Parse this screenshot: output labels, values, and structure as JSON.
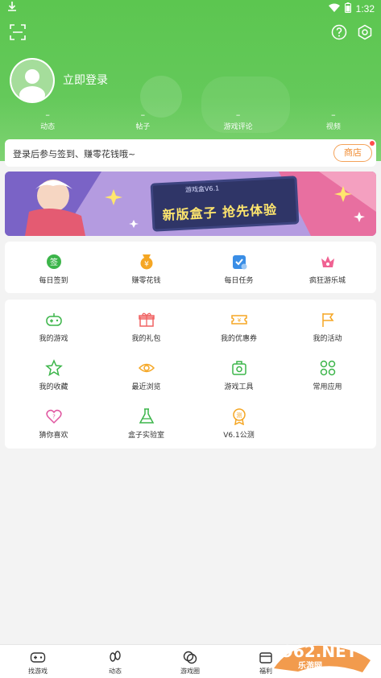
{
  "status_bar": {
    "time": "1:32"
  },
  "profile": {
    "login_label": "立即登录"
  },
  "stats": [
    {
      "value": "–",
      "label": "动态"
    },
    {
      "value": "–",
      "label": "帖子"
    },
    {
      "value": "–",
      "label": "游戏评论"
    },
    {
      "value": "–",
      "label": "视频"
    }
  ],
  "notice": {
    "text": "登录后参与签到、赚零花钱哦~",
    "shop_label": "商店"
  },
  "banner": {
    "version": "游戏盒V6.1",
    "title": "新版盒子  抢先体验"
  },
  "quick_actions": [
    {
      "label": "每日签到",
      "icon": "checkin-icon",
      "color": "#3cb54a"
    },
    {
      "label": "赚零花钱",
      "icon": "coin-icon",
      "color": "#f5a623"
    },
    {
      "label": "每日任务",
      "icon": "task-icon",
      "color": "#3a8ee6"
    },
    {
      "label": "疯狂游乐城",
      "icon": "crown-icon",
      "color": "#f06292"
    }
  ],
  "menu": [
    {
      "label": "我的游戏",
      "icon": "gamepad-icon"
    },
    {
      "label": "我的礼包",
      "icon": "gift-icon"
    },
    {
      "label": "我的优惠券",
      "icon": "coupon-icon"
    },
    {
      "label": "我的活动",
      "icon": "flag-icon"
    },
    {
      "label": "我的收藏",
      "icon": "star-icon"
    },
    {
      "label": "最近浏览",
      "icon": "eye-icon"
    },
    {
      "label": "游戏工具",
      "icon": "toolbox-icon"
    },
    {
      "label": "常用应用",
      "icon": "apps-icon"
    },
    {
      "label": "猜你喜欢",
      "icon": "heart-question-icon"
    },
    {
      "label": "盒子实验室",
      "icon": "flask-icon"
    },
    {
      "label": "V6.1公测",
      "icon": "badge-icon"
    }
  ],
  "bottom_nav": [
    {
      "label": "找游戏"
    },
    {
      "label": "动态"
    },
    {
      "label": "游戏圈"
    },
    {
      "label": "福利"
    }
  ],
  "watermark": {
    "text": "962.NET",
    "sub": "乐游网"
  },
  "colors": {
    "header_green": "#5cc650",
    "menu_icon_green": "#3cb54a",
    "shop_orange": "#f08a2e"
  }
}
